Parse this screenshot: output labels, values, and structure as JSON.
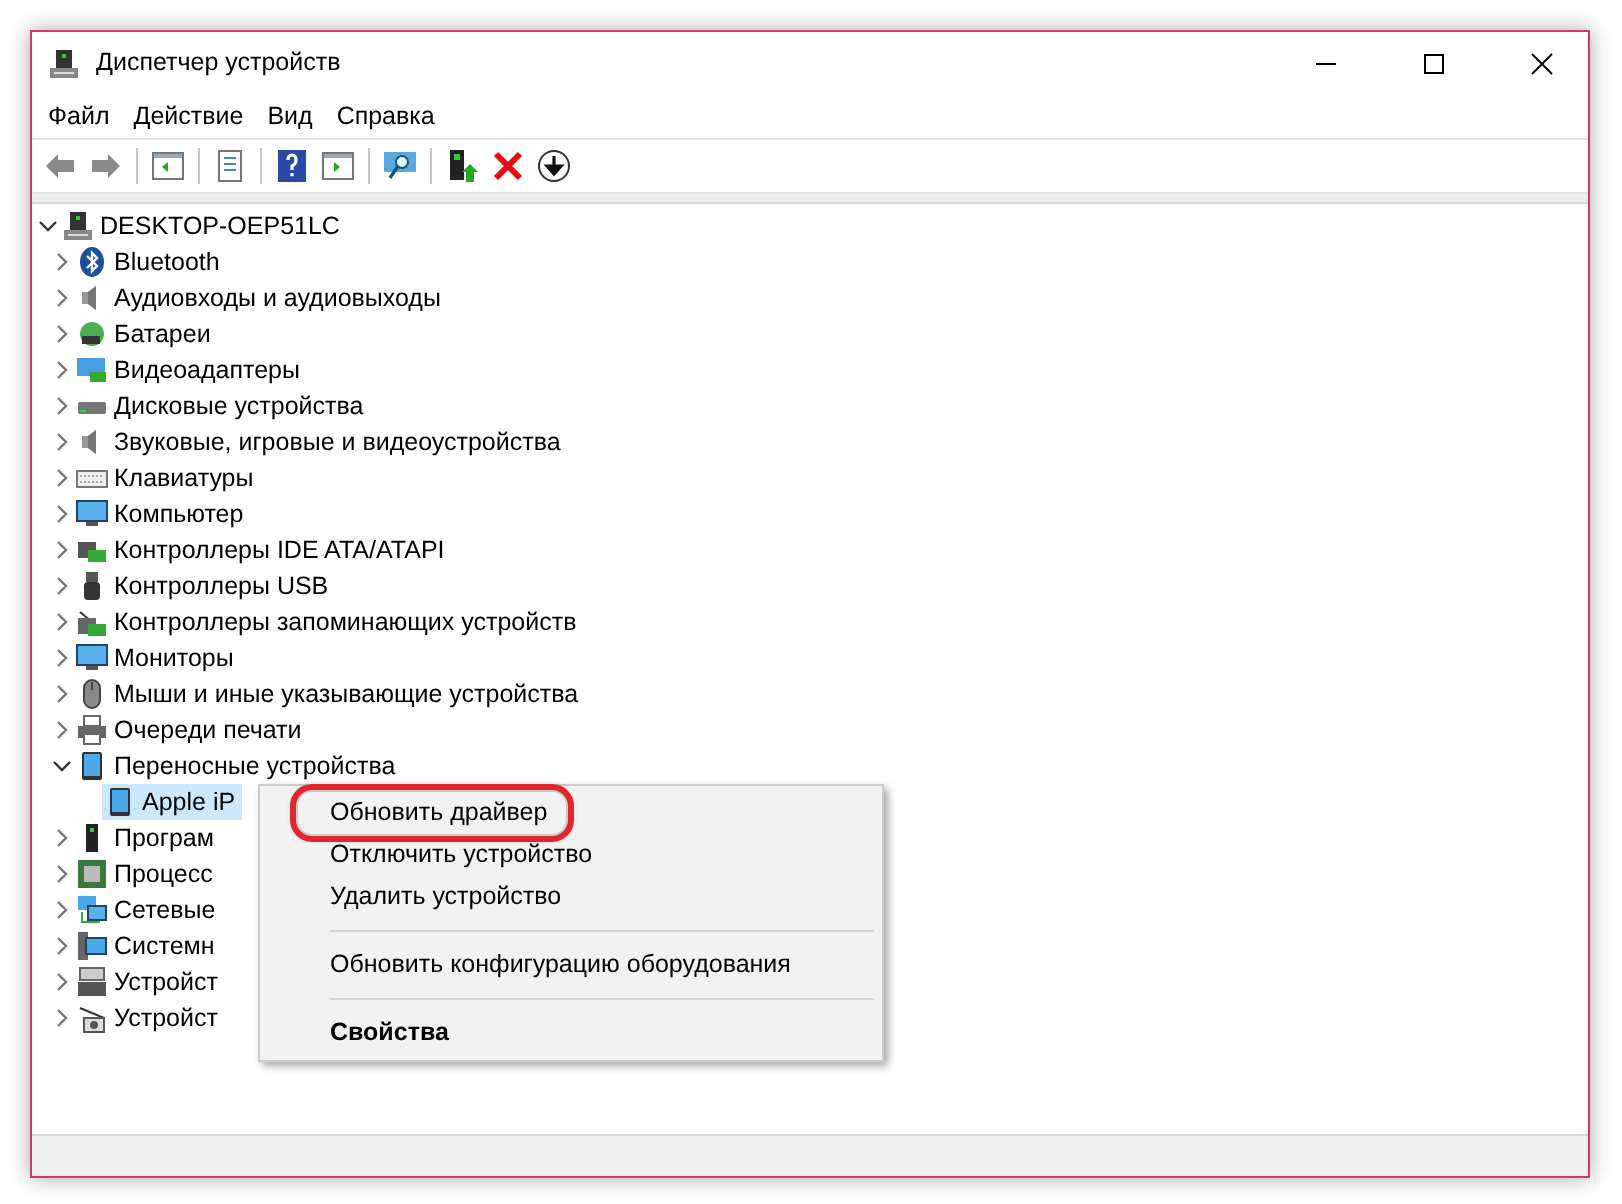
{
  "window": {
    "title": "Диспетчер устройств"
  },
  "menu": [
    "Файл",
    "Действие",
    "Вид",
    "Справка"
  ],
  "tree": {
    "label": "DESKTOP-OEP51LC",
    "expanded": true,
    "selected": false,
    "children": [
      {
        "label": "Bluetooth",
        "expanded": false,
        "selected": false
      },
      {
        "label": "Аудиовходы и аудиовыходы",
        "expanded": false,
        "selected": false
      },
      {
        "label": "Батареи",
        "expanded": false,
        "selected": false
      },
      {
        "label": "Видеоадаптеры",
        "expanded": false,
        "selected": false
      },
      {
        "label": "Дисковые устройства",
        "expanded": false,
        "selected": false
      },
      {
        "label": "Звуковые, игровые и видеоустройства",
        "expanded": false,
        "selected": false
      },
      {
        "label": "Клавиатуры",
        "expanded": false,
        "selected": false
      },
      {
        "label": "Компьютер",
        "expanded": false,
        "selected": false
      },
      {
        "label": "Контроллеры IDE ATA/ATAPI",
        "expanded": false,
        "selected": false
      },
      {
        "label": "Контроллеры USB",
        "expanded": false,
        "selected": false
      },
      {
        "label": "Контроллеры запоминающих устройств",
        "expanded": false,
        "selected": false
      },
      {
        "label": "Мониторы",
        "expanded": false,
        "selected": false
      },
      {
        "label": "Мыши и иные указывающие устройства",
        "expanded": false,
        "selected": false
      },
      {
        "label": "Очереди печати",
        "expanded": false,
        "selected": false
      },
      {
        "label": "Переносные устройства",
        "expanded": true,
        "selected": false,
        "children": [
          {
            "label": "Apple iP",
            "selected": true
          }
        ]
      },
      {
        "label": "Програм",
        "expanded": false,
        "selected": false
      },
      {
        "label": "Процесс",
        "expanded": false,
        "selected": false
      },
      {
        "label": "Сетевые",
        "expanded": false,
        "selected": false
      },
      {
        "label": "Системн",
        "expanded": false,
        "selected": false
      },
      {
        "label": "Устройст",
        "expanded": false,
        "selected": false
      },
      {
        "label": "Устройст",
        "expanded": false,
        "selected": false
      }
    ]
  },
  "context_menu": {
    "items": [
      {
        "kind": "item",
        "label": "Обновить драйвер",
        "default": false,
        "highlighted": true
      },
      {
        "kind": "item",
        "label": "Отключить устройство",
        "default": false,
        "highlighted": false
      },
      {
        "kind": "item",
        "label": "Удалить устройство",
        "default": false,
        "highlighted": false
      },
      {
        "kind": "separator"
      },
      {
        "kind": "item",
        "label": "Обновить конфигурацию оборудования",
        "default": false,
        "highlighted": false
      },
      {
        "kind": "separator"
      },
      {
        "kind": "item",
        "label": "Свойства",
        "default": true,
        "highlighted": false
      }
    ]
  }
}
